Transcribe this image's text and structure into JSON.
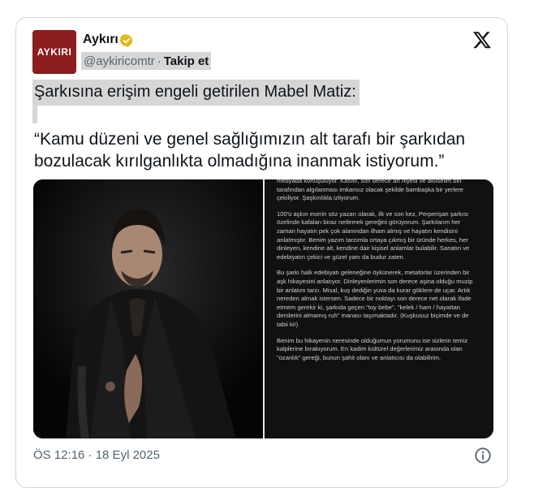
{
  "author": {
    "avatar_text": "AYKIRI",
    "name": "Aykırı",
    "handle": "@aykiricomtr",
    "separator": "·",
    "follow_label": "Takip et",
    "verified_color": "#e2b719"
  },
  "tweet": {
    "headline": "Şarkısına erişim engeli getirilen Mabel Matiz:",
    "quote": "“Kamu düzeni ve genel sağlığımızın alt tarafı bir şarkıdan bozulacak kırılganlıkta olmadığına inanmak istiyorum.”",
    "timestamp": "ÖS 12:16 · 18 Eyl 2025"
  },
  "statement": {
    "paragraphs": [
      "medyada konuşuluyor. Kasıtlı, son derece art niyetli ve akılselim biri tarafından algılanması imkansız olacak şekilde bambaşka bir yerlere çekiliyor. Şaşkınlıkla izliyorum.",
      "100'ü aşkın eserin söz yazarı olarak, ilk ve son kez, Perperişan şarkısı özelinde kafaları biraz netlemek gereğini görüyorum. Şarkılarım her zaman hayatın pek çok alanından ilham almış ve hayatın kendisini anlatmıştır. Benim yazım tarzımla ortaya çıkmış bir üründe herkes, her dinleyen, kendine ait, kendine dair kişisel anlamlar bulabilir. Sanatın ve edebiyatın çekici ve güzel yanı da budur zaten.",
      "Bu şarkı halk edebiyatı geleneğine öykünerek, metaforlar üzerinden bir aşk hikayesini anlatıyor. Dinleyenlerimin son derece aşina olduğu muzip bir anlatım tarzı. Misal, kuş dediğin yuva da kurar göklere de uçar. Artık nereden almak istersen. Sadece bir noktayı son derece net olarak ifade etmem gerekir ki, şarkıda geçen \"toy bebe\", \"kelek / ham / hayattan derslerini almamış ruh\" manası taşımaktadır. (Kuşkusuz biçimde ve de tabii ki!)",
      "Benim bu hikayenin neresinde olduğumun yorumunu ise sizlerin temiz kalplerine bırakıyorum. En kadim kültürel değerlerimiz arasında olan \"ozanlık\" gereği, bunun şahit olanı ve anlatıcısı da olabilirim."
    ]
  }
}
